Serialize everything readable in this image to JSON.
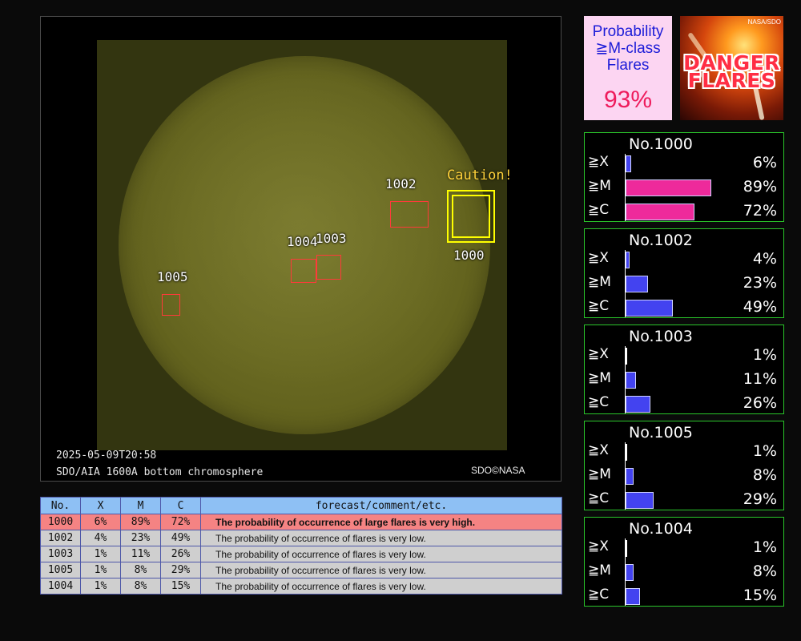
{
  "image": {
    "timestamp": "2025-05-09T20:58",
    "caption": "SDO/AIA 1600A bottom chromosphere",
    "credit": "SDO©NASA",
    "caution_label": "Caution!",
    "regions": [
      {
        "id": "1000",
        "caution": true
      },
      {
        "id": "1002",
        "caution": false
      },
      {
        "id": "1003",
        "caution": false
      },
      {
        "id": "1004",
        "caution": false
      },
      {
        "id": "1005",
        "caution": false
      }
    ]
  },
  "table": {
    "headers": [
      "No.",
      "X",
      "M",
      "C",
      "forecast/comment/etc."
    ],
    "rows": [
      {
        "no": "1000",
        "x": "6%",
        "m": "89%",
        "c": "72%",
        "comment": "The probability of occurrence of large flares is very high.",
        "danger": true
      },
      {
        "no": "1002",
        "x": "4%",
        "m": "23%",
        "c": "49%",
        "comment": "The probability of occurrence of flares is very low.",
        "danger": false
      },
      {
        "no": "1003",
        "x": "1%",
        "m": "11%",
        "c": "26%",
        "comment": "The probability of occurrence of flares is very low.",
        "danger": false
      },
      {
        "no": "1005",
        "x": "1%",
        "m": "8%",
        "c": "29%",
        "comment": "The probability of occurrence of flares is very low.",
        "danger": false
      },
      {
        "no": "1004",
        "x": "1%",
        "m": "8%",
        "c": "15%",
        "comment": "The probability of occurrence of flares is very low.",
        "danger": false
      }
    ]
  },
  "summary": {
    "title_lines": [
      "Probability",
      "≧M-class",
      "Flares"
    ],
    "value": "93%"
  },
  "danger_banner": {
    "credit": "NASA/SDO",
    "line1": "DANGER",
    "line2": "FLARES"
  },
  "panels": [
    {
      "title": "No.1000",
      "rows": [
        {
          "label": "≧X",
          "value": "6%",
          "pct": 6,
          "color": "#4343f0"
        },
        {
          "label": "≧M",
          "value": "89%",
          "pct": 89,
          "color": "#ee2a9b"
        },
        {
          "label": "≧C",
          "value": "72%",
          "pct": 72,
          "color": "#ee2a9b"
        }
      ]
    },
    {
      "title": "No.1002",
      "rows": [
        {
          "label": "≧X",
          "value": "4%",
          "pct": 4,
          "color": "#4343f0"
        },
        {
          "label": "≧M",
          "value": "23%",
          "pct": 23,
          "color": "#4343f0"
        },
        {
          "label": "≧C",
          "value": "49%",
          "pct": 49,
          "color": "#4343f0"
        }
      ]
    },
    {
      "title": "No.1003",
      "rows": [
        {
          "label": "≧X",
          "value": "1%",
          "pct": 1,
          "color": "#4343f0"
        },
        {
          "label": "≧M",
          "value": "11%",
          "pct": 11,
          "color": "#4343f0"
        },
        {
          "label": "≧C",
          "value": "26%",
          "pct": 26,
          "color": "#4343f0"
        }
      ]
    },
    {
      "title": "No.1005",
      "rows": [
        {
          "label": "≧X",
          "value": "1%",
          "pct": 1,
          "color": "#4343f0"
        },
        {
          "label": "≧M",
          "value": "8%",
          "pct": 8,
          "color": "#4343f0"
        },
        {
          "label": "≧C",
          "value": "29%",
          "pct": 29,
          "color": "#4343f0"
        }
      ]
    },
    {
      "title": "No.1004",
      "rows": [
        {
          "label": "≧X",
          "value": "1%",
          "pct": 1,
          "color": "#4343f0"
        },
        {
          "label": "≧M",
          "value": "8%",
          "pct": 8,
          "color": "#4343f0"
        },
        {
          "label": "≧C",
          "value": "15%",
          "pct": 15,
          "color": "#4343f0"
        }
      ]
    }
  ]
}
